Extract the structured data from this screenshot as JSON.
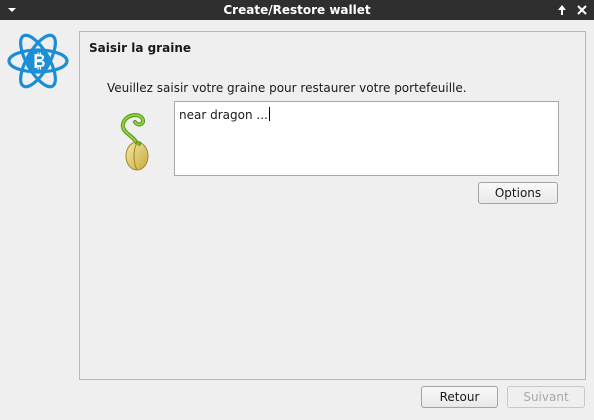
{
  "window": {
    "title": "Create/Restore wallet",
    "menu_icon": "chevron-down-icon",
    "maximize_icon": "arrow-up-icon",
    "close_icon": "close-icon"
  },
  "logo": {
    "icon": "electrum-bitcoin-logo",
    "color": "#1c8ed8"
  },
  "page": {
    "title": "Saisir la graine",
    "instruction": "Veuillez saisir votre graine pour restaurer votre portefeuille.",
    "seed_icon": "seed-sprout-icon",
    "seed_value": "near dragon ..."
  },
  "buttons": {
    "options": "Options",
    "back": "Retour",
    "next": "Suivant"
  }
}
